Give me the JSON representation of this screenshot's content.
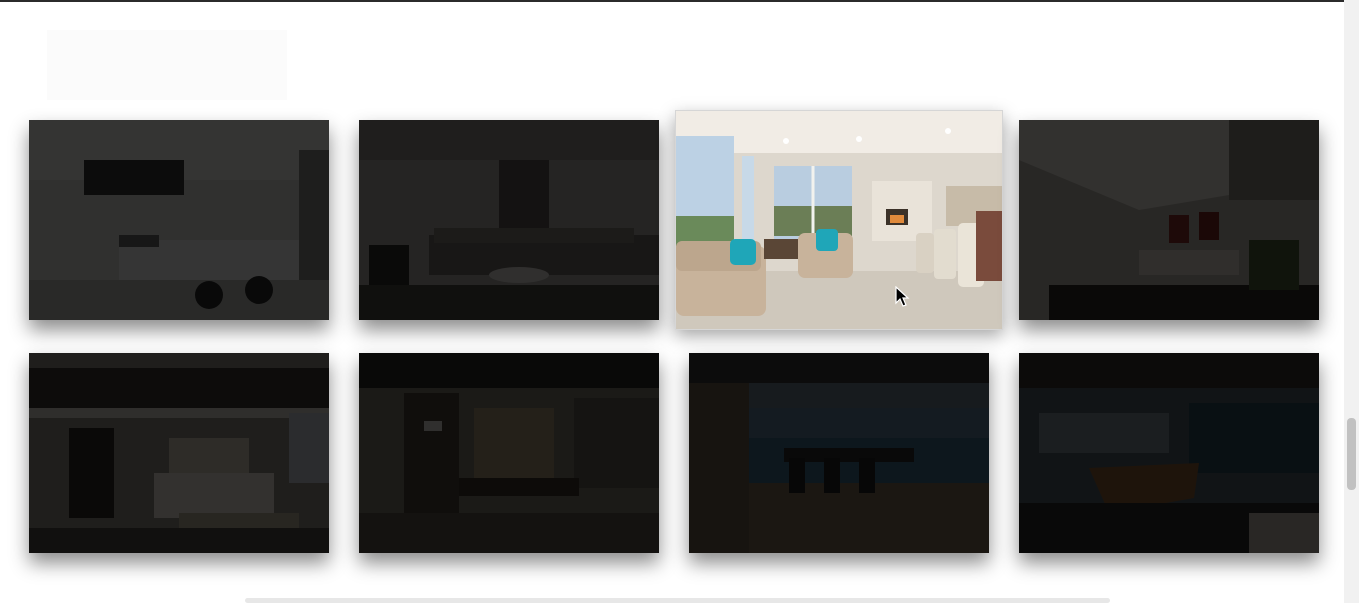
{
  "gallery": {
    "tiles": [
      {
        "name": "kitchen-photo",
        "state": "dimmed"
      },
      {
        "name": "living-room-sectional-photo",
        "state": "dimmed"
      },
      {
        "name": "bright-living-room-photo",
        "state": "highlighted"
      },
      {
        "name": "loft-living-room-photo",
        "state": "dimmed"
      },
      {
        "name": "bedroom-photo",
        "state": "dimmed"
      },
      {
        "name": "office-dining-photo",
        "state": "dimmed"
      },
      {
        "name": "dining-room-ocean-view-photo",
        "state": "dimmed"
      },
      {
        "name": "long-dining-table-photo",
        "state": "dimmed"
      }
    ]
  },
  "colors": {
    "overlay": "#000000",
    "page_background": "#ffffff",
    "sofa": "#c8b39b",
    "pillow": "#1fa6b8"
  }
}
